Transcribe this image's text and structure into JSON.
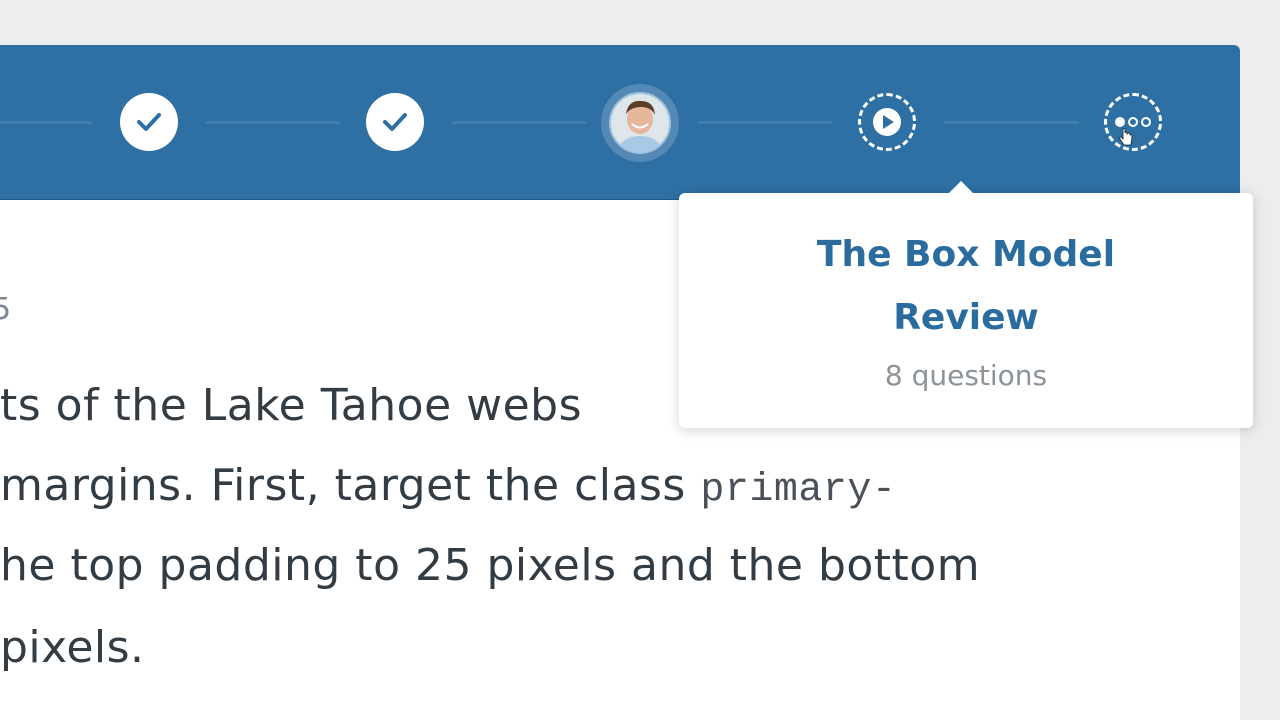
{
  "progress": {
    "steps": [
      {
        "state": "complete",
        "icon": "check-icon"
      },
      {
        "state": "complete",
        "icon": "check-icon"
      },
      {
        "state": "current",
        "icon": "avatar"
      },
      {
        "state": "upcoming",
        "icon": "play-icon"
      },
      {
        "state": "upcoming",
        "icon": "more-icon"
      }
    ],
    "colors": {
      "bar": "#2e70a4",
      "check": "#2e70a4",
      "line": "#3f7fb0"
    }
  },
  "content": {
    "label_fragment": "5",
    "lines": [
      "ts of the Lake Tahoe webs",
      "margins. First, target the class ",
      "he top padding to 25 pixels and the bottom",
      " pixels."
    ],
    "code_text": "primary-"
  },
  "tooltip": {
    "title": "The Box Model Review",
    "count": "8 questions"
  }
}
